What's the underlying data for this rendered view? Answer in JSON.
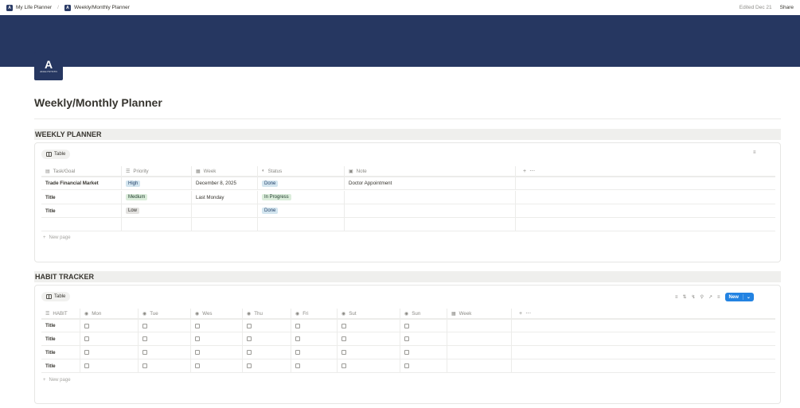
{
  "breadcrumb": {
    "items": [
      "My Life Planner",
      "Weekly/Monthly Planner"
    ],
    "separator": "/"
  },
  "topbar": {
    "edited": "Edited Dec 21",
    "share": "Share"
  },
  "page_icon": {
    "letter": "A",
    "caption": "ANALYSYSTN"
  },
  "page_title": "Weekly/Monthly Planner",
  "colors": {
    "cover": "#263761",
    "accent": "#2383e2"
  },
  "weekly": {
    "heading": "WEEKLY PLANNER",
    "view_tab": "Table",
    "columns": [
      "Task/Goal",
      "Priority",
      "Week",
      "Status",
      "Note"
    ],
    "column_icons": [
      "title-icon",
      "list-icon",
      "calendar-icon",
      "status-icon",
      "note-icon"
    ],
    "rows": [
      {
        "task": "Trade Financial Market",
        "priority": "High",
        "week": "December 8, 2025",
        "status": "Done",
        "note": "Doctor Appointment"
      },
      {
        "task": "Title",
        "priority": "Medium",
        "week": "Last Monday",
        "status": "In Progress",
        "note": ""
      },
      {
        "task": "Title",
        "priority": "Low",
        "week": "",
        "status": "Done",
        "note": ""
      }
    ],
    "new_page": "New page"
  },
  "habit": {
    "heading": "HABIT TRACKER",
    "view_tab": "Table",
    "new_button": "New",
    "columns": [
      "HABIT",
      "Mon",
      "Tue",
      "Wes",
      "Thu",
      "Fri",
      "Sut",
      "Sun",
      "Week"
    ],
    "rows": [
      {
        "habit": "Title",
        "checks": [
          false,
          false,
          false,
          false,
          false,
          false,
          false
        ]
      },
      {
        "habit": "Title",
        "checks": [
          false,
          false,
          false,
          false,
          false,
          false,
          false
        ]
      },
      {
        "habit": "Title",
        "checks": [
          false,
          false,
          false,
          false,
          false,
          false,
          false
        ]
      },
      {
        "habit": "Title",
        "checks": [
          false,
          false,
          false,
          false,
          false,
          false,
          false
        ]
      }
    ],
    "new_page": "New page"
  }
}
